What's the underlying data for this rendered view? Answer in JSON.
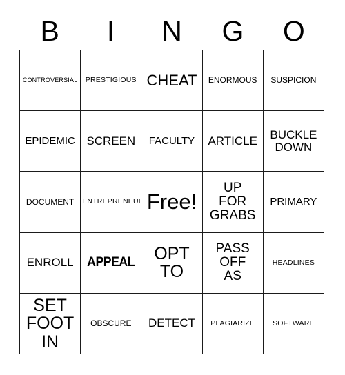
{
  "header": {
    "letters": [
      "B",
      "I",
      "N",
      "G",
      "O"
    ]
  },
  "grid": {
    "rows": 5,
    "columns": 5,
    "border_color": "#1b1b1b",
    "background_color": "#ffffff",
    "text_color": "#000000",
    "cells": [
      {
        "text": "CONTROVERSIAL",
        "size": "fs-xs",
        "style": "normal",
        "row": 1,
        "col": 1
      },
      {
        "text": "PRESTIGIOUS",
        "size": "fs-s",
        "style": "normal",
        "row": 1,
        "col": 2
      },
      {
        "text": "CHEAT",
        "size": "fs-xl",
        "style": "normal",
        "row": 1,
        "col": 3
      },
      {
        "text": "ENORMOUS",
        "size": "fs-sm",
        "style": "normal",
        "row": 1,
        "col": 4
      },
      {
        "text": "SUSPICION",
        "size": "fs-sm",
        "style": "normal",
        "row": 1,
        "col": 5
      },
      {
        "text": "EPIDEMIC",
        "size": "fs-m",
        "style": "normal",
        "row": 2,
        "col": 1
      },
      {
        "text": "SCREEN",
        "size": "fs-ml",
        "style": "normal",
        "row": 2,
        "col": 2
      },
      {
        "text": "FACULTY",
        "size": "fs-m",
        "style": "normal",
        "row": 2,
        "col": 3
      },
      {
        "text": "ARTICLE",
        "size": "fs-ml",
        "style": "normal",
        "row": 2,
        "col": 4
      },
      {
        "text": "BUCKLE\nDOWN",
        "size": "fs-ml",
        "style": "normal",
        "row": 2,
        "col": 5
      },
      {
        "text": "DOCUMENT",
        "size": "fs-sm",
        "style": "normal",
        "row": 3,
        "col": 1
      },
      {
        "text": "ENTREPRENEUR",
        "size": "fs-s",
        "style": "normal",
        "row": 3,
        "col": 2
      },
      {
        "text": "Free!",
        "size": "fs-free",
        "style": "normal",
        "row": 3,
        "col": 3
      },
      {
        "text": "UP\nFOR\nGRABS",
        "size": "fs-l",
        "style": "normal",
        "row": 3,
        "col": 4
      },
      {
        "text": "PRIMARY",
        "size": "fs-m",
        "style": "normal",
        "row": 3,
        "col": 5
      },
      {
        "text": "ENROLL",
        "size": "fs-ml",
        "style": "normal",
        "row": 4,
        "col": 1
      },
      {
        "text": "APPEAL",
        "size": "",
        "style": "bold-condensed",
        "row": 4,
        "col": 2
      },
      {
        "text": "OPT\nTO",
        "size": "fs-xxl",
        "style": "normal",
        "row": 4,
        "col": 3
      },
      {
        "text": "PASS\nOFF\nAS",
        "size": "fs-l",
        "style": "normal",
        "row": 4,
        "col": 4
      },
      {
        "text": "HEADLINES",
        "size": "fs-s",
        "style": "normal",
        "row": 4,
        "col": 5
      },
      {
        "text": "SET\nFOOT\nIN",
        "size": "fs-xxl",
        "style": "normal",
        "row": 5,
        "col": 1
      },
      {
        "text": "OBSCURE",
        "size": "fs-sm",
        "style": "normal",
        "row": 5,
        "col": 2
      },
      {
        "text": "DETECT",
        "size": "fs-ml",
        "style": "normal",
        "row": 5,
        "col": 3
      },
      {
        "text": "PLAGIARIZE",
        "size": "fs-s",
        "style": "normal",
        "row": 5,
        "col": 4
      },
      {
        "text": "SOFTWARE",
        "size": "fs-s",
        "style": "normal",
        "row": 5,
        "col": 5
      }
    ]
  }
}
